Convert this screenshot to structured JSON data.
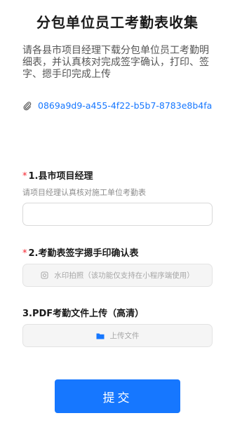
{
  "form": {
    "title": "分包单位员工考勤表收集",
    "description": "请各县市项目经理下载分包单位员工考勤明细表，并认真核对完成签字确认，打印、签字、摁手印完成上传",
    "attachment": {
      "icon": "paperclip-icon",
      "name": "0869a9d9-a455-4f22-b5b7-8783e8b4fa"
    }
  },
  "questions": [
    {
      "required_mark": "*",
      "label": "1.县市项目经理",
      "hint": "请项目经理认真核对施工单位考勤表",
      "value": ""
    },
    {
      "required_mark": "*",
      "label": "2.考勤表签字摁手印确认表",
      "button_icon": "camera-icon",
      "button_label": "水印拍照（该功能仅支持在小程序端使用）"
    },
    {
      "label": "3.PDF考勤文件上传（高清）",
      "button_icon": "folder-icon",
      "button_label": "上传文件"
    }
  ],
  "submit": {
    "label": "提交",
    "color": "#1677ff"
  }
}
